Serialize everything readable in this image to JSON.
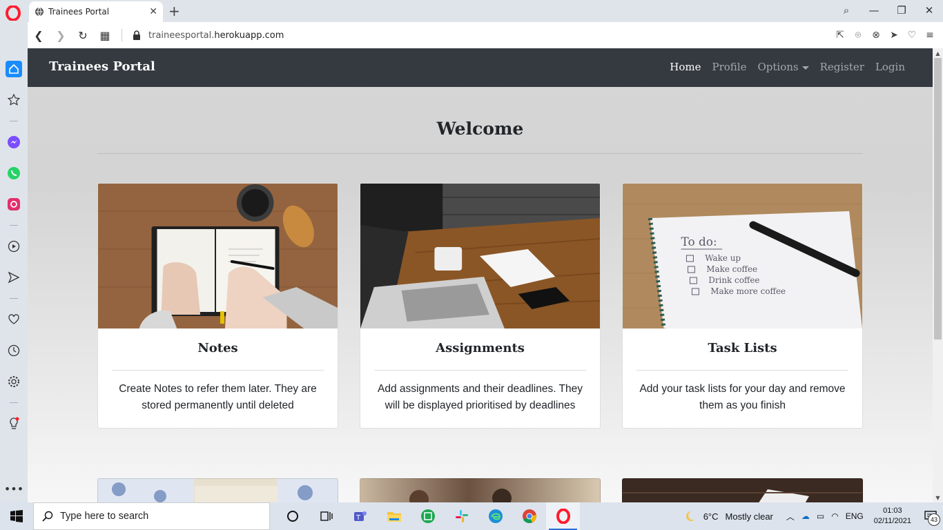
{
  "browser": {
    "tab_title": "Trainees Portal",
    "url_prefix": "traineesportal.",
    "url_domain": "herokuapp.com",
    "accent": "#ff1b2d"
  },
  "sidebar": {
    "items": [
      "home-icon",
      "bookmarks-icon",
      "messenger-icon",
      "whatsapp-icon",
      "instagram-icon",
      "player-icon",
      "send-icon",
      "heart-icon",
      "history-icon",
      "settings-icon",
      "bulb-icon",
      "more-icon"
    ]
  },
  "navbar": {
    "brand": "Trainees Portal",
    "links": [
      "Home",
      "Profile",
      "Options",
      "Register",
      "Login"
    ],
    "background": "#343a40"
  },
  "page": {
    "heading": "Welcome"
  },
  "cards": [
    {
      "title": "Notes",
      "text": "Create Notes to refer them later. They are stored permanently until deleted"
    },
    {
      "title": "Assignments",
      "text": "Add assignments and their deadlines. They will be displayed prioritised by deadlines"
    },
    {
      "title": "Task Lists",
      "text": "Add your task lists for your day and remove them as you finish"
    }
  ],
  "tasklist_image_text": [
    "To do:",
    "Wake up",
    "Make coffee",
    "Drink coffee",
    "Make more coffee"
  ],
  "taskbar": {
    "search_placeholder": "Type here to search",
    "weather_temp": "6°C",
    "weather_text": "Mostly clear",
    "language": "ENG",
    "time": "01:03",
    "date": "02/11/2021",
    "notification_count": "43"
  }
}
